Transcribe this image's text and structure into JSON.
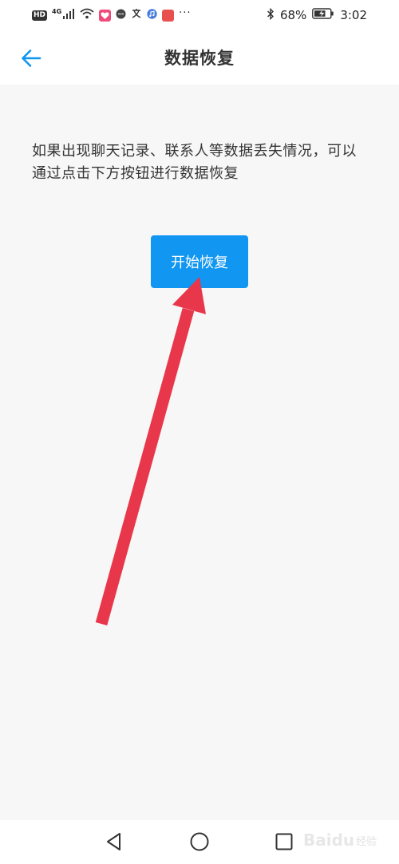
{
  "status_bar": {
    "hd": "HD",
    "network": "4G",
    "dots": "···",
    "battery": "68%",
    "time": "3:02"
  },
  "header": {
    "title": "数据恢复"
  },
  "content": {
    "description": "如果出现聊天记录、联系人等数据丢失情况，可以通过点击下方按钮进行数据恢复",
    "button_label": "开始恢复"
  },
  "watermark": {
    "brand": "Baidu",
    "sub": "经验"
  },
  "colors": {
    "accent": "#1196f1",
    "annotation_arrow": "#e8374a"
  },
  "icons": {
    "back": "arrow-left-icon",
    "nav_back": "triangle-back-icon",
    "nav_home": "circle-home-icon",
    "nav_recent": "square-recent-icon"
  }
}
